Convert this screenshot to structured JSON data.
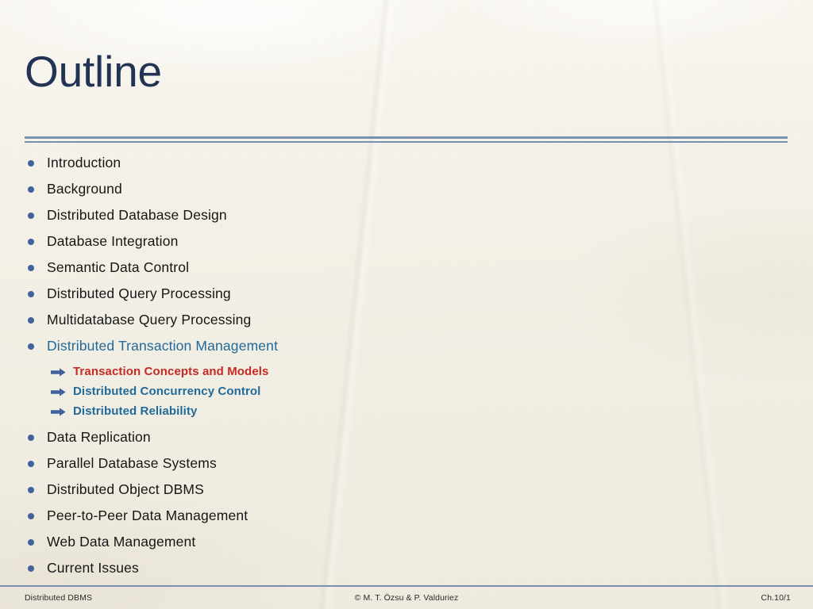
{
  "slide": {
    "title": "Outline",
    "background_color": "#f3f0e8",
    "title_color": "#223355",
    "rule_color": "#7b8fae",
    "bullet_color": "#41629d",
    "accent_blue": "#226a99",
    "accent_red": "#c62a22",
    "body_text_color": "#161616"
  },
  "outline": {
    "items": [
      {
        "label": "Introduction",
        "state": "normal",
        "bullet_icon": "bullet-dot-icon"
      },
      {
        "label": "Background",
        "state": "normal",
        "bullet_icon": "bullet-dot-icon"
      },
      {
        "label": "Distributed Database Design",
        "state": "normal",
        "bullet_icon": "bullet-dot-icon"
      },
      {
        "label": "Database Integration",
        "state": "normal",
        "bullet_icon": "bullet-dot-icon"
      },
      {
        "label": "Semantic Data Control",
        "state": "normal",
        "bullet_icon": "bullet-dot-icon"
      },
      {
        "label": "Distributed Query Processing",
        "state": "normal",
        "bullet_icon": "bullet-dot-icon"
      },
      {
        "label": "Multidatabase Query Processing",
        "state": "normal",
        "bullet_icon": "bullet-dot-icon"
      },
      {
        "label": "Distributed Transaction Management",
        "state": "current",
        "bullet_icon": "bullet-dot-icon"
      }
    ],
    "sub_items": [
      {
        "label": "Transaction Concepts and Models",
        "state": "highlight",
        "marker_icon": "arrow-right-icon"
      },
      {
        "label": "Distributed Concurrency Control",
        "state": "normal",
        "marker_icon": "arrow-right-icon"
      },
      {
        "label": "Distributed Reliability",
        "state": "normal",
        "marker_icon": "arrow-right-icon"
      }
    ],
    "items_after": [
      {
        "label": "Data Replication",
        "state": "normal",
        "bullet_icon": "bullet-dot-icon"
      },
      {
        "label": "Parallel Database Systems",
        "state": "normal",
        "bullet_icon": "bullet-dot-icon"
      },
      {
        "label": "Distributed Object DBMS",
        "state": "normal",
        "bullet_icon": "bullet-dot-icon"
      },
      {
        "label": "Peer-to-Peer Data Management",
        "state": "normal",
        "bullet_icon": "bullet-dot-icon"
      },
      {
        "label": "Web Data Management",
        "state": "normal",
        "bullet_icon": "bullet-dot-icon"
      },
      {
        "label": "Current Issues",
        "state": "normal",
        "bullet_icon": "bullet-dot-icon"
      }
    ]
  },
  "footer": {
    "left": "Distributed DBMS",
    "center": "© M. T. Özsu & P. Valduriez",
    "right": "Ch.10/1"
  }
}
